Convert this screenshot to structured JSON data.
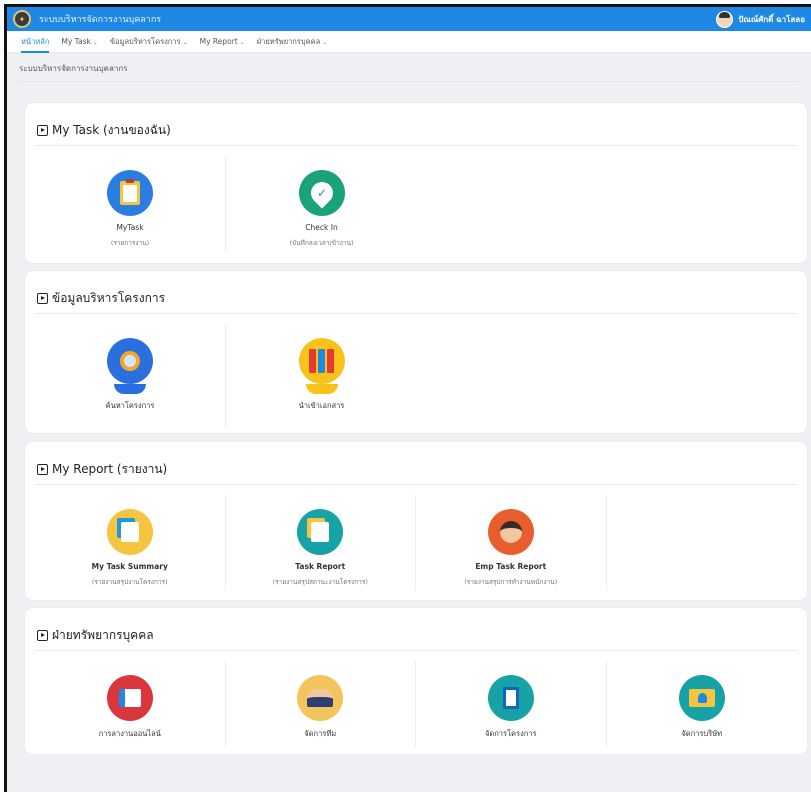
{
  "header": {
    "app_title": "ระบบบริหารจัดการงานบุคลากร",
    "user_name": "ปัณณ์ศักดิ์ ฉาโลลอ"
  },
  "nav": {
    "items": [
      {
        "label": "หน้าหลัก",
        "dropdown": false,
        "active": true
      },
      {
        "label": "My Task",
        "dropdown": true,
        "active": false
      },
      {
        "label": "ข้อมูลบริหารโครงการ",
        "dropdown": true,
        "active": false
      },
      {
        "label": "My Report",
        "dropdown": true,
        "active": false
      },
      {
        "label": "ฝ่ายทรัพยากรบุคคล",
        "dropdown": true,
        "active": false
      }
    ],
    "caret": "⌄"
  },
  "breadcrumb": "ระบบบริหารจัดการงานบุคลากร",
  "sections": {
    "mytask": {
      "title": "My Task (งานของฉัน)",
      "tiles": [
        {
          "label": "MyTask",
          "sub": "(รายการงาน)"
        },
        {
          "label": "Check In",
          "sub": "(บันทึกลงเวลาเข้างาน)"
        }
      ]
    },
    "project": {
      "title": "ข้อมูลบริหารโครงการ",
      "tiles": [
        {
          "label": "ค้นหาโครงการ"
        },
        {
          "label": "นำเข้าเอกสาร"
        }
      ]
    },
    "report": {
      "title": "My Report (รายงาน)",
      "tiles": [
        {
          "label": "My Task Summary",
          "sub": "(รายงานสรุปงานโครงการ)"
        },
        {
          "label": "Task Report",
          "sub": "(รายงานสรุปสถานะงานโครงการ)"
        },
        {
          "label": "Emp Task Report",
          "sub": "(รายงานสรุปการทำงานพนักงาน)"
        }
      ]
    },
    "hr": {
      "title": "ฝ่ายทรัพยากรบุคคล",
      "tiles": [
        {
          "label": "การลางานออนไลน์"
        },
        {
          "label": "จัดการทีม"
        },
        {
          "label": "จัดการโครงการ"
        },
        {
          "label": "จัดการบริษัท"
        }
      ]
    }
  },
  "colors": {
    "topbar": "#1e88e5",
    "mytask_icon": "#2a7de1",
    "checkin_icon": "#1aa37a",
    "search_icon": "#2a6fe0",
    "import_icon": "#f7c31a",
    "summary_icon": "#f5c542",
    "taskreport_icon": "#17a2a6",
    "emp_icon": "#e85d2c",
    "leave_icon": "#d9363e",
    "team_icon": "#f2c55c",
    "projmgmt_icon": "#17a2a6",
    "company_icon": "#17a2a6"
  }
}
